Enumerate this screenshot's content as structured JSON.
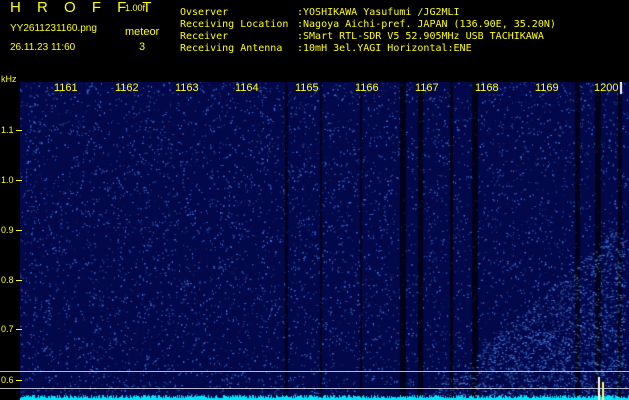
{
  "header": {
    "title": "H R O F F T",
    "version": "1.00f",
    "filename": "YY2611231160.png",
    "meteor_label": "meteor",
    "meteor_count": "3",
    "datetime": "26.11.23 11:60"
  },
  "station_info": [
    {
      "key": "Ovserver",
      "value": ":YOSHIKAWA Yasufumi /JG2MLI"
    },
    {
      "key": "Receiving Location",
      "value": ":Nagoya Aichi-pref. JAPAN (136.90E, 35.20N)"
    },
    {
      "key": "Receiver",
      "value": ":SMart RTL-SDR V5 52.905MHz USB TACHIKAWA"
    },
    {
      "key": "Receiving Antenna",
      "value": ":10mH 3el.YAGI Horizontal:ENE"
    }
  ],
  "spectrogram": {
    "freq_unit": "kHz",
    "y_ticks": [
      "1.1",
      "1.0",
      "0.9",
      "0.8",
      "0.7",
      "0.6"
    ],
    "x_ticks": [
      "1161",
      "1162",
      "1163",
      "1164",
      "1165",
      "1166",
      "1167",
      "1168",
      "1169",
      "1200"
    ],
    "colors": {
      "background": "#03084a",
      "dots": "#3a7bff",
      "noise_floor": "#00e5ff",
      "labels": "#ffff00"
    }
  }
}
